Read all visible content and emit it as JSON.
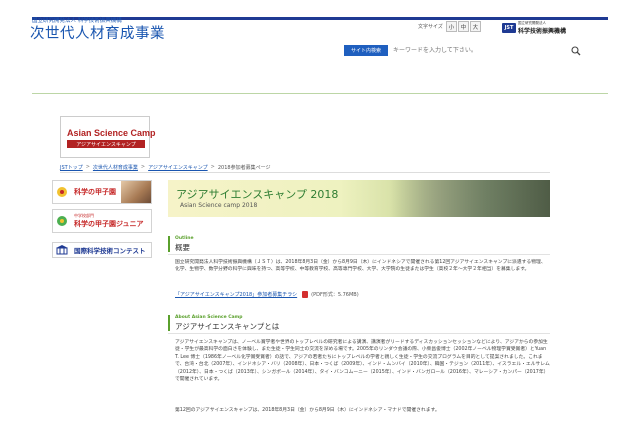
{
  "header": {
    "org_name": "国立研究開発法人 科学技術振興機構",
    "site_title": "次世代人材育成事業",
    "font_size_label": "文字サイズ",
    "font_sizes": [
      "小",
      "中",
      "大"
    ],
    "jst_mark": "JST",
    "jst_sub": "国立研究開発法人",
    "jst_name": "科学技術振興機構",
    "search_button": "サイト内検索",
    "search_placeholder": "キーワードを入力して下さい。"
  },
  "logo": {
    "title": "Asian Science Camp",
    "subtitle": "アジアサイエンスキャンプ"
  },
  "breadcrumb": [
    "JSTトップ",
    "次世代人材育成事業",
    "アジアサイエンスキャンプ",
    "2018参加者募集ページ"
  ],
  "sidebar": {
    "banners": [
      {
        "label": "科学の甲子園"
      },
      {
        "mini": "中学校部門",
        "label": "科学の甲子園ジュニア"
      },
      {
        "label": "国際科学技術コンテスト"
      }
    ]
  },
  "main_banner": {
    "title": "アジアサイエンスキャンプ 2018",
    "subtitle": "Asian Science camp 2018"
  },
  "outline": {
    "en": "Outline",
    "ja": "概要",
    "text": "国立研究開発法人科学技術振興機構（ＪＳＴ）は、2018年8月3日（金）から8月9日（木）にインドネシアで開催される第12回アジアサイエンスキャンプに派遣する物理、化学、生物学、数学分野の科学に興味を持つ、高等学校、中等教育学校、高等専門学校、大学、大学院の生徒または学生（高校２年～大学２年相当）を募集します。",
    "flyer_link": "「アジアサイエンスキャンプ2018」参加者募集チラシ",
    "flyer_size": "(PDF形式：5.76MB)"
  },
  "about": {
    "en": "About Asian Science Camp",
    "ja": "アジアサイエンスキャンプとは",
    "text": "アジアサイエンスキャンプは、ノーベル賞学者や世界のトップレベルの研究者による講演、講演者がリードするディスカッションセッションなどにより、アジアからの参加生徒・学生が最高科学の面白さを体験し、また生徒・学生同士の交流を深める場です。2005年のリンダウ会議の際、小柴昌俊博士（2002年ノーベル物理学賞受賞者）とYuan T. Lee 博士（1986年ノーベル化学賞受賞者）の話で、アジアの若者たちにトップレベルの学者と親しく生徒・学生の交流プログラムを目的として提案されました。これまで、台湾・台北（2007年）、インドネシア・バリ（2008年）、日本・つくば（2009年）、インド・ムンバイ（2010年）、韓国・テジョン（2011年）、イスラエル・エルサレム（2012年）、日本・つくば（2013年）、シンガポール（2014年）、タイ・バンコムーニー（2015年）、インド・バンガロール（2016年）、マレーシア・カンパー（2017年）で開催されています。",
    "text2": "第12回のアジアサイエンスキャンプは、2018年8月3日（金）から8月9日（木）にインドネシア・マナドで開催されます。"
  }
}
